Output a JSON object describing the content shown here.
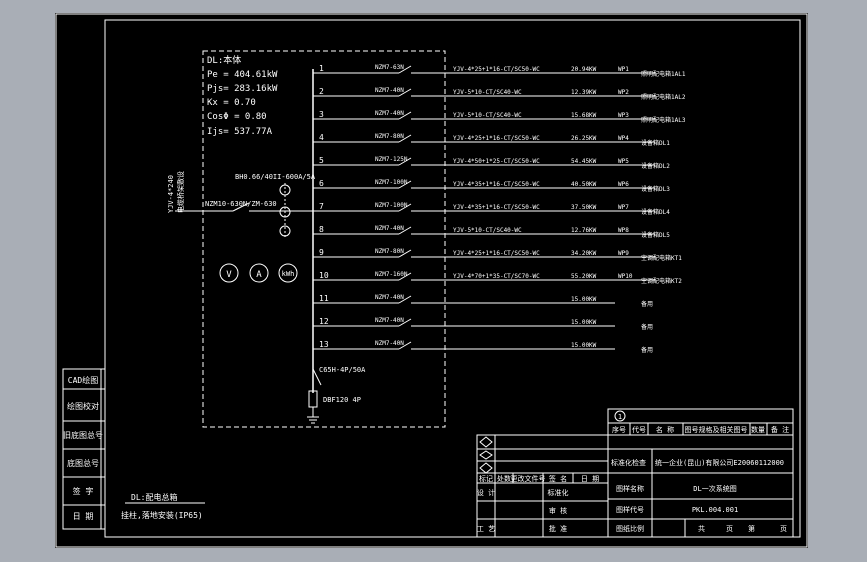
{
  "summary": {
    "title": "DL:本体",
    "pe": "Pe = 404.61kW",
    "pjs": "Pjs= 283.16kW",
    "kx": "Kx = 0.70",
    "cos": "CosΦ = 0.80",
    "ijs": "Ijs= 537.77A"
  },
  "incoming": {
    "cable": "YJV-4*240",
    "cable2": "电缆桥架敷设",
    "breaker": "NZM10-630N/ZM-630",
    "ct": "BH0.66/40II-600A/5A"
  },
  "meters": [
    "V",
    "A",
    "kWh"
  ],
  "circuits": [
    {
      "n": "1",
      "brk": "NZM7-63N",
      "cable": "YJV-4*25+1*16-CT/SC50-WC",
      "pwr": "20.94KW",
      "wp": "WP1",
      "dest": "照明配电箱1AL1"
    },
    {
      "n": "2",
      "brk": "NZM7-40N",
      "cable": "YJV-5*10-CT/SC40-WC",
      "pwr": "12.39KW",
      "wp": "WP2",
      "dest": "照明配电箱1AL2"
    },
    {
      "n": "3",
      "brk": "NZM7-40N",
      "cable": "YJV-5*10-CT/SC40-WC",
      "pwr": "15.68KW",
      "wp": "WP3",
      "dest": "照明配电箱1AL3"
    },
    {
      "n": "4",
      "brk": "NZM7-80N",
      "cable": "YJV-4*25+1*16-CT/SC50-WC",
      "pwr": "26.25KW",
      "wp": "WP4",
      "dest": "设备箱DL1"
    },
    {
      "n": "5",
      "brk": "NZM7-125N",
      "cable": "YJV-4*50+1*25-CT/SC50-WC",
      "pwr": "54.45KW",
      "wp": "WP5",
      "dest": "设备箱DL2"
    },
    {
      "n": "6",
      "brk": "NZM7-100N",
      "cable": "YJV-4*35+1*16-CT/SC50-WC",
      "pwr": "40.50KW",
      "wp": "WP6",
      "dest": "设备箱DL3"
    },
    {
      "n": "7",
      "brk": "NZM7-100N",
      "cable": "YJV-4*35+1*16-CT/SC50-WC",
      "pwr": "37.50KW",
      "wp": "WP7",
      "dest": "设备箱DL4"
    },
    {
      "n": "8",
      "brk": "NZM7-40N",
      "cable": "YJV-5*10-CT/SC40-WC",
      "pwr": "12.76KW",
      "wp": "WP8",
      "dest": "设备箱DL5"
    },
    {
      "n": "9",
      "brk": "NZM7-80N",
      "cable": "YJV-4*25+1*16-CT/SC50-WC",
      "pwr": "34.20KW",
      "wp": "WP9",
      "dest": "空调配电箱KT1"
    },
    {
      "n": "10",
      "brk": "NZM7-160N",
      "cable": "YJV-4*70+1*35-CT/SC70-WC",
      "pwr": "55.20KW",
      "wp": "WP10",
      "dest": "空调配电箱KT2"
    },
    {
      "n": "11",
      "brk": "NZM7-40N",
      "cable": "",
      "pwr": "15.00KW",
      "wp": "",
      "dest": "备用"
    },
    {
      "n": "12",
      "brk": "NZM7-40N",
      "cable": "",
      "pwr": "15.00KW",
      "wp": "",
      "dest": "备用"
    },
    {
      "n": "13",
      "brk": "NZM7-40N",
      "cable": "",
      "pwr": "15.00KW",
      "wp": "",
      "dest": "备用"
    }
  ],
  "spd": {
    "breaker": "C65H-4P/50A",
    "device": "DBF120 4P"
  },
  "panel_note": {
    "title": "DL:配电总箱",
    "desc": "挂柱,落地安装(IP65)"
  },
  "left_strip": [
    "CAD绘图",
    "绘图校对",
    "旧底图总号",
    "底图总号",
    "签 字",
    "日 期"
  ],
  "title_block": {
    "rev_header": [
      "序号",
      "代号",
      "名 称",
      "图号规格及相关图号",
      "数量",
      "备 注"
    ],
    "rev_no": "1",
    "company_label": "标准化检查",
    "company": "统一企业(昆山)有限公司E20060112000",
    "sign_header": [
      "标记",
      "处数",
      "更改文件号",
      "签 名",
      "日 期"
    ],
    "design": "设 计",
    "standardize": "标准化",
    "drawing_name_label": "图样名称",
    "drawing_name": "DL一次系统图",
    "review": "审 核",
    "drawing_code_label": "图样代号",
    "drawing_code": "PKL.004.001",
    "craft": "工 艺",
    "approve": "批 准",
    "scale_label": "图纸比例",
    "total": "共",
    "page": "页",
    "sheet": "第",
    "page2": "页"
  }
}
